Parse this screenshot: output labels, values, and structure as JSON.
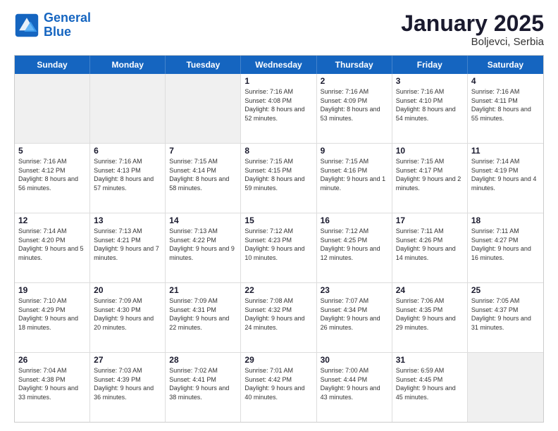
{
  "logo": {
    "line1": "General",
    "line2": "Blue"
  },
  "title": "January 2025",
  "subtitle": "Boljevci, Serbia",
  "header_days": [
    "Sunday",
    "Monday",
    "Tuesday",
    "Wednesday",
    "Thursday",
    "Friday",
    "Saturday"
  ],
  "weeks": [
    [
      {
        "day": "",
        "info": "",
        "shaded": true
      },
      {
        "day": "",
        "info": "",
        "shaded": true
      },
      {
        "day": "",
        "info": "",
        "shaded": true
      },
      {
        "day": "1",
        "info": "Sunrise: 7:16 AM\nSunset: 4:08 PM\nDaylight: 8 hours and 52 minutes."
      },
      {
        "day": "2",
        "info": "Sunrise: 7:16 AM\nSunset: 4:09 PM\nDaylight: 8 hours and 53 minutes."
      },
      {
        "day": "3",
        "info": "Sunrise: 7:16 AM\nSunset: 4:10 PM\nDaylight: 8 hours and 54 minutes."
      },
      {
        "day": "4",
        "info": "Sunrise: 7:16 AM\nSunset: 4:11 PM\nDaylight: 8 hours and 55 minutes."
      }
    ],
    [
      {
        "day": "5",
        "info": "Sunrise: 7:16 AM\nSunset: 4:12 PM\nDaylight: 8 hours and 56 minutes."
      },
      {
        "day": "6",
        "info": "Sunrise: 7:16 AM\nSunset: 4:13 PM\nDaylight: 8 hours and 57 minutes."
      },
      {
        "day": "7",
        "info": "Sunrise: 7:15 AM\nSunset: 4:14 PM\nDaylight: 8 hours and 58 minutes."
      },
      {
        "day": "8",
        "info": "Sunrise: 7:15 AM\nSunset: 4:15 PM\nDaylight: 8 hours and 59 minutes."
      },
      {
        "day": "9",
        "info": "Sunrise: 7:15 AM\nSunset: 4:16 PM\nDaylight: 9 hours and 1 minute."
      },
      {
        "day": "10",
        "info": "Sunrise: 7:15 AM\nSunset: 4:17 PM\nDaylight: 9 hours and 2 minutes."
      },
      {
        "day": "11",
        "info": "Sunrise: 7:14 AM\nSunset: 4:19 PM\nDaylight: 9 hours and 4 minutes."
      }
    ],
    [
      {
        "day": "12",
        "info": "Sunrise: 7:14 AM\nSunset: 4:20 PM\nDaylight: 9 hours and 5 minutes."
      },
      {
        "day": "13",
        "info": "Sunrise: 7:13 AM\nSunset: 4:21 PM\nDaylight: 9 hours and 7 minutes."
      },
      {
        "day": "14",
        "info": "Sunrise: 7:13 AM\nSunset: 4:22 PM\nDaylight: 9 hours and 9 minutes."
      },
      {
        "day": "15",
        "info": "Sunrise: 7:12 AM\nSunset: 4:23 PM\nDaylight: 9 hours and 10 minutes."
      },
      {
        "day": "16",
        "info": "Sunrise: 7:12 AM\nSunset: 4:25 PM\nDaylight: 9 hours and 12 minutes."
      },
      {
        "day": "17",
        "info": "Sunrise: 7:11 AM\nSunset: 4:26 PM\nDaylight: 9 hours and 14 minutes."
      },
      {
        "day": "18",
        "info": "Sunrise: 7:11 AM\nSunset: 4:27 PM\nDaylight: 9 hours and 16 minutes."
      }
    ],
    [
      {
        "day": "19",
        "info": "Sunrise: 7:10 AM\nSunset: 4:29 PM\nDaylight: 9 hours and 18 minutes."
      },
      {
        "day": "20",
        "info": "Sunrise: 7:09 AM\nSunset: 4:30 PM\nDaylight: 9 hours and 20 minutes."
      },
      {
        "day": "21",
        "info": "Sunrise: 7:09 AM\nSunset: 4:31 PM\nDaylight: 9 hours and 22 minutes."
      },
      {
        "day": "22",
        "info": "Sunrise: 7:08 AM\nSunset: 4:32 PM\nDaylight: 9 hours and 24 minutes."
      },
      {
        "day": "23",
        "info": "Sunrise: 7:07 AM\nSunset: 4:34 PM\nDaylight: 9 hours and 26 minutes."
      },
      {
        "day": "24",
        "info": "Sunrise: 7:06 AM\nSunset: 4:35 PM\nDaylight: 9 hours and 29 minutes."
      },
      {
        "day": "25",
        "info": "Sunrise: 7:05 AM\nSunset: 4:37 PM\nDaylight: 9 hours and 31 minutes."
      }
    ],
    [
      {
        "day": "26",
        "info": "Sunrise: 7:04 AM\nSunset: 4:38 PM\nDaylight: 9 hours and 33 minutes."
      },
      {
        "day": "27",
        "info": "Sunrise: 7:03 AM\nSunset: 4:39 PM\nDaylight: 9 hours and 36 minutes."
      },
      {
        "day": "28",
        "info": "Sunrise: 7:02 AM\nSunset: 4:41 PM\nDaylight: 9 hours and 38 minutes."
      },
      {
        "day": "29",
        "info": "Sunrise: 7:01 AM\nSunset: 4:42 PM\nDaylight: 9 hours and 40 minutes."
      },
      {
        "day": "30",
        "info": "Sunrise: 7:00 AM\nSunset: 4:44 PM\nDaylight: 9 hours and 43 minutes."
      },
      {
        "day": "31",
        "info": "Sunrise: 6:59 AM\nSunset: 4:45 PM\nDaylight: 9 hours and 45 minutes."
      },
      {
        "day": "",
        "info": "",
        "shaded": true
      }
    ]
  ]
}
